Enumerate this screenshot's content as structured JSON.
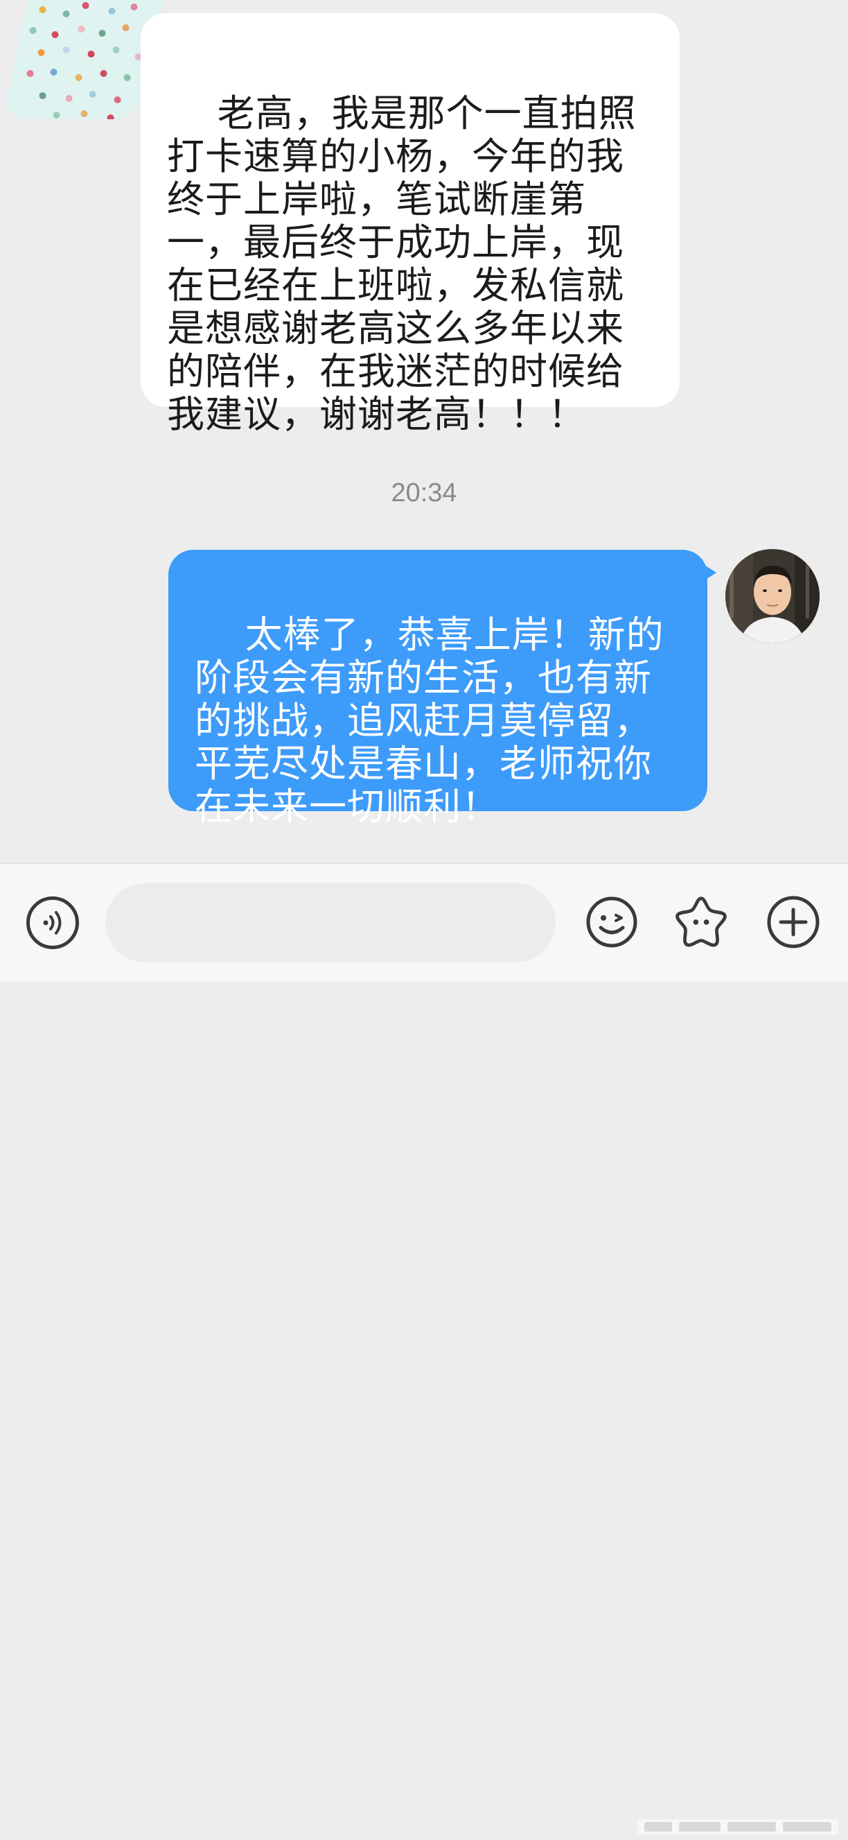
{
  "conversation": {
    "incoming_message": "老高，我是那个一直拍照打卡速算的小杨，今年的我终于上岸啦，笔试断崖第一，最后终于成功上岸，现在已经在上班啦，发私信就是想感谢老高这么多年以来的陪伴，在我迷茫的时候给我建议，谢谢老高！！！",
    "timestamp": "20:34",
    "outgoing_message": "太棒了，恭喜上岸！新的阶段会有新的生活，也有新的挑战，追风赶月莫停留，平芜尽处是春山，老师祝你在未来一切顺利！"
  },
  "input_bar": {
    "input_value": "",
    "icons": [
      "voice-icon",
      "emoji-icon",
      "sticker-icon",
      "plus-icon"
    ]
  },
  "colors": {
    "background": "#ededed",
    "incoming_bubble": "#ffffff",
    "outgoing_bubble": "#3d9bfa",
    "timestamp": "#8a8a8a"
  }
}
